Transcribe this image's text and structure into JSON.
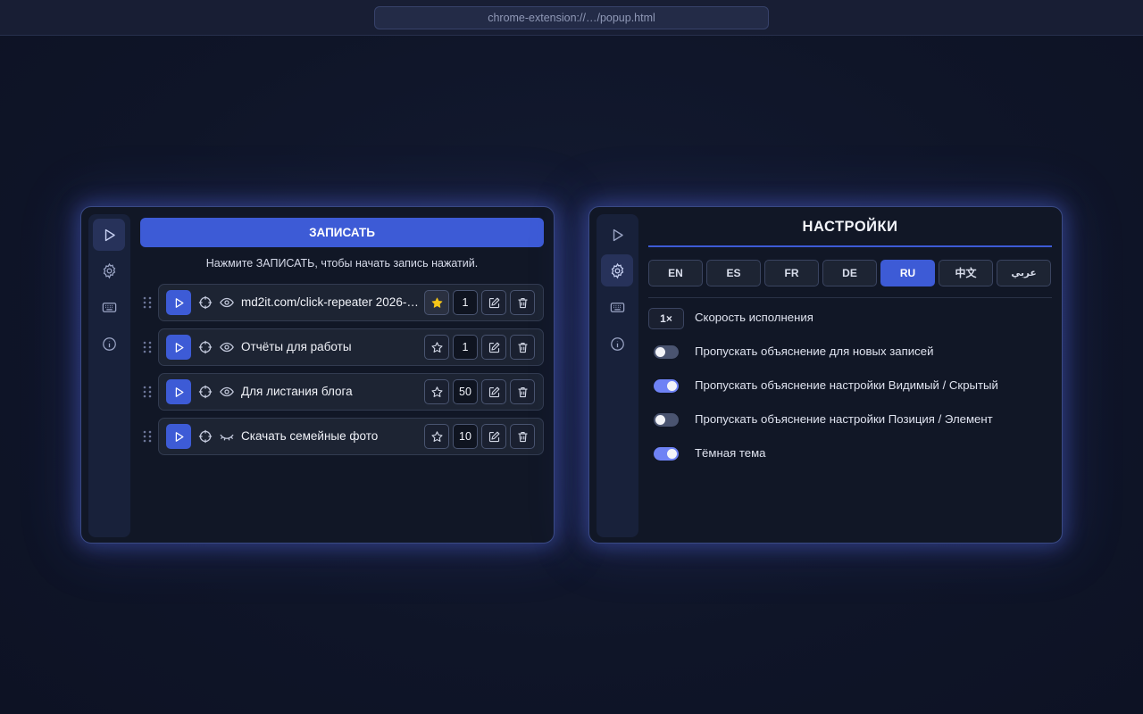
{
  "browser": {
    "url": "chrome-extension://…/popup.html"
  },
  "nav": [
    {
      "icon": "play-icon"
    },
    {
      "icon": "gear-icon"
    },
    {
      "icon": "keyboard-icon"
    },
    {
      "icon": "info-icon"
    }
  ],
  "recorder": {
    "record_label": "ЗАПИСАТЬ",
    "hint": "Нажмите ЗАПИСАТЬ, чтобы начать запись нажатий.",
    "items": [
      {
        "title": "md2it.com/click-repeater 2026-…",
        "count": "1",
        "starred": true,
        "visible": true
      },
      {
        "title": "Отчёты для работы",
        "count": "1",
        "starred": false,
        "visible": true
      },
      {
        "title": "Для листания блога",
        "count": "50",
        "starred": false,
        "visible": true
      },
      {
        "title": "Скачать семейные фото",
        "count": "10",
        "starred": false,
        "visible": false
      }
    ]
  },
  "settings": {
    "title": "НАСТРОЙКИ",
    "languages": [
      "EN",
      "ES",
      "FR",
      "DE",
      "RU",
      "中文",
      "عربي"
    ],
    "active_language": "RU",
    "speed": {
      "value": "1×",
      "label": "Скорость исполнения"
    },
    "options": [
      {
        "label": "Пропускать объяснение для новых записей",
        "on": false
      },
      {
        "label": "Пропускать объяснение настройки Видимый / Скрытый",
        "on": true
      },
      {
        "label": "Пропускать объяснение настройки Позиция / Элемент",
        "on": false
      },
      {
        "label": "Тёмная тема",
        "on": true
      }
    ]
  },
  "colors": {
    "accent": "#3d5bd6",
    "background": "#0f1528",
    "panel": "#111726",
    "star": "#f5c518"
  }
}
